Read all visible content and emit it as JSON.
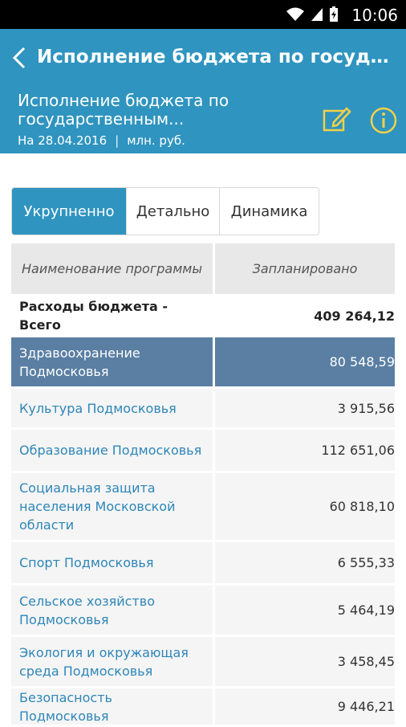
{
  "status_bar": {
    "time": "10:06"
  },
  "app_bar": {
    "title": "Исполнение бюджета по госуда...",
    "subtitle": "Исполнение бюджета по государственным...",
    "date": "На 28.04.2016",
    "separator": "|",
    "units": "млн. руб."
  },
  "tabs": [
    {
      "label": "Укрупненно",
      "active": true
    },
    {
      "label": "Детально",
      "active": false
    },
    {
      "label": "Динамика",
      "active": false
    }
  ],
  "table": {
    "headers": {
      "name": "Наименование программы",
      "planned": "Запланировано"
    },
    "rows": [
      {
        "name": "Расходы бюджета - Всего",
        "value": "409 264,12"
      },
      {
        "name": "Здравоохранение Подмосковья",
        "value": "80 548,59"
      },
      {
        "name": "Культура Подмосковья",
        "value": "3 915,56"
      },
      {
        "name": "Образование Подмосковья",
        "value": "112 651,06"
      },
      {
        "name": "Социальная защита населения Московской области",
        "value": "60 818,10"
      },
      {
        "name": "Спорт Подмосковья",
        "value": "6 555,33"
      },
      {
        "name": "Сельское хозяйство Подмосковья",
        "value": "5 464,19"
      },
      {
        "name": "Экология и окружающая среда Подмосковья",
        "value": "3 458,45"
      },
      {
        "name": "Безопасность Подмосковья",
        "value": "9 446,21"
      }
    ]
  },
  "colors": {
    "accent": "#2f94bf",
    "selected_row": "#5a7fa3",
    "link": "#2e86b8"
  }
}
